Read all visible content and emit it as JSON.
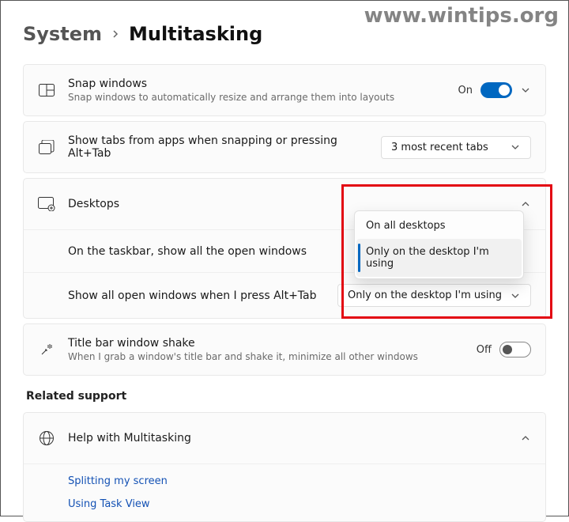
{
  "watermark": "www.wintips.org",
  "breadcrumb": {
    "parent": "System",
    "current": "Multitasking"
  },
  "snap": {
    "title": "Snap windows",
    "desc": "Snap windows to automatically resize and arrange them into layouts",
    "state_label": "On"
  },
  "tabs": {
    "title": "Show tabs from apps when snapping or pressing Alt+Tab",
    "selected": "3 most recent tabs"
  },
  "desktops": {
    "title": "Desktops",
    "row1_label": "On the taskbar, show all the open windows",
    "row2_label": "Show all open windows when I press Alt+Tab",
    "row2_selected": "Only on the desktop I'm using",
    "menu": {
      "opt1": "On all desktops",
      "opt2": "Only on the desktop I'm using"
    }
  },
  "shake": {
    "title": "Title bar window shake",
    "desc": "When I grab a window's title bar and shake it, minimize all other windows",
    "state_label": "Off"
  },
  "related": {
    "heading": "Related support",
    "help_title": "Help with Multitasking",
    "link1": "Splitting my screen",
    "link2": "Using Task View"
  }
}
